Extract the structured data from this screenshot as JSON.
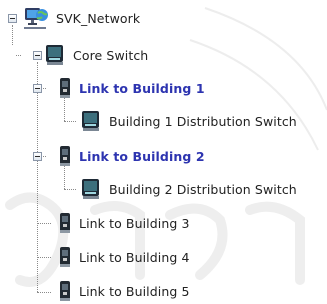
{
  "tree": {
    "root_label": "SVK_Network",
    "nodes": [
      {
        "label": "Core Switch",
        "bold": true
      },
      {
        "label": "Link to Building 1",
        "bold": true
      },
      {
        "label": "Building 1 Distribution Switch",
        "bold": false
      },
      {
        "label": "Link to Building 2",
        "bold": true
      },
      {
        "label": "Building 2 Distribution Switch",
        "bold": false
      },
      {
        "label": "Link to Building 3",
        "bold": false
      },
      {
        "label": "Link to Building 4",
        "bold": false
      },
      {
        "label": "Link to Building 5",
        "bold": false
      }
    ]
  },
  "colors": {
    "bold_label": "#2d34b0",
    "normal_label": "#222222",
    "connector": "#8a8a8a"
  },
  "icons": {
    "root": "network-globe-icon",
    "switch": "network-switch-icon",
    "link": "network-link-icon"
  }
}
